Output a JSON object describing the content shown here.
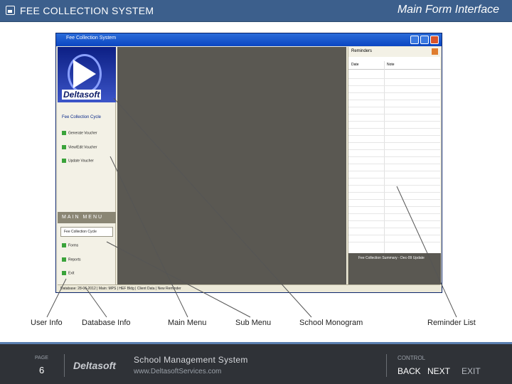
{
  "header": {
    "title": "FEE COLLECTION SYSTEM",
    "subtitle": "Main Form Interface",
    "icon": "save-disk-icon"
  },
  "app_window": {
    "title": "Fee Collection System",
    "logo_text": "Deltasoft",
    "left_panel": {
      "cycle_heading": "Fee Collection Cycle",
      "items": [
        "Generate Voucher",
        "View/Edit Voucher",
        "Update Voucher"
      ],
      "main_menu": "MAIN MENU",
      "submenu_selected": "Fee Collection Cycle",
      "submenu_items": [
        "Forms",
        "Reports",
        "Exit"
      ]
    },
    "reminder": {
      "title": "Reminders",
      "columns": [
        "Date",
        "Note"
      ],
      "footer_text": "Fee Collection Summary - Dec-09 Update"
    },
    "status_bar": "Database: 28-06-2012 | Main: MPS | HEF Bldg | Client Data | New Reminder"
  },
  "annotations": [
    "User Info",
    "Database Info",
    "Main Menu",
    "Sub Menu",
    "School Monogram",
    "Reminder List"
  ],
  "footer": {
    "page_label": "PAGE",
    "page_number": "6",
    "brand": "Deltasoft",
    "system_title": "School Management System",
    "url": "www.DeltasoftServices.com",
    "control_label": "CONTROL",
    "back": "BACK",
    "next": "NEXT",
    "exit": "EXIT"
  },
  "colors": {
    "header_bg": "#3c5f8c",
    "footer_bg": "#2f3237",
    "center_bg": "#5a5852"
  }
}
